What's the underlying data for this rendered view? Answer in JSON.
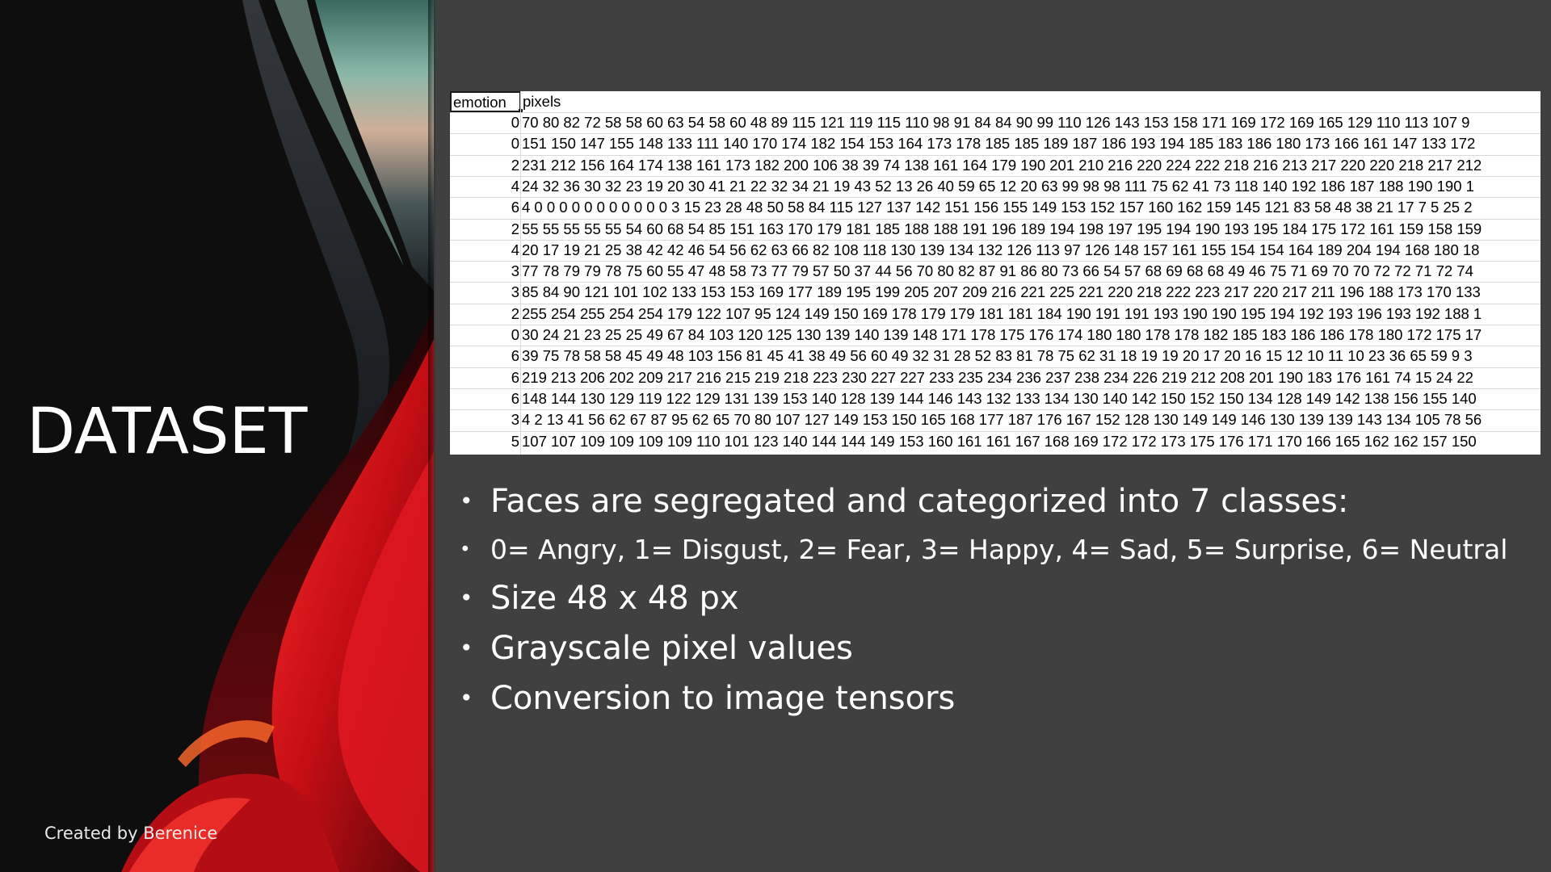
{
  "slide": {
    "title": "DATASET",
    "credit": "Created by Berenice"
  },
  "spreadsheet": {
    "columns": [
      "emotion",
      "pixels"
    ],
    "rows": [
      {
        "emotion": "0",
        "pixels": "70 80 82 72 58 58 60 63 54 58 60 48 89 115 121 119 115 110 98 91 84 84 90 99 110 126 143 153 158 171 169 172 169 165 129 110 113 107 9"
      },
      {
        "emotion": "0",
        "pixels": "151 150 147 155 148 133 111 140 170 174 182 154 153 164 173 178 185 185 189 187 186 193 194 185 183 186 180 173 166 161 147 133 172"
      },
      {
        "emotion": "2",
        "pixels": "231 212 156 164 174 138 161 173 182 200 106 38 39 74 138 161 164 179 190 201 210 216 220 224 222 218 216 213 217 220 220 218 217 212"
      },
      {
        "emotion": "4",
        "pixels": "24 32 36 30 32 23 19 20 30 41 21 22 32 34 21 19 43 52 13 26 40 59 65 12 20 63 99 98 98 111 75 62 41 73 118 140 192 186 187 188 190 190 1"
      },
      {
        "emotion": "6",
        "pixels": "4 0 0 0 0 0 0 0 0 0 0 0 3 15 23 28 48 50 58 84 115 127 137 142 151 156 155 149 153 152 157 160 162 159 145 121 83 58 48 38 21 17 7 5 25 2"
      },
      {
        "emotion": "2",
        "pixels": "55 55 55 55 55 54 60 68 54 85 151 163 170 179 181 185 188 188 191 196 189 194 198 197 195 194 190 193 195 184 175 172 161 159 158 159"
      },
      {
        "emotion": "4",
        "pixels": "20 17 19 21 25 38 42 42 46 54 56 62 63 66 82 108 118 130 139 134 132 126 113 97 126 148 157 161 155 154 154 164 189 204 194 168 180 18"
      },
      {
        "emotion": "3",
        "pixels": "77 78 79 79 78 75 60 55 47 48 58 73 77 79 57 50 37 44 56 70 80 82 87 91 86 80 73 66 54 57 68 69 68 68 49 46 75 71 69 70 70 72 72 71 72 74"
      },
      {
        "emotion": "3",
        "pixels": "85 84 90 121 101 102 133 153 153 169 177 189 195 199 205 207 209 216 221 225 221 220 218 222 223 217 220 217 211 196 188 173 170 133"
      },
      {
        "emotion": "2",
        "pixels": "255 254 255 254 254 179 122 107 95 124 149 150 169 178 179 179 181 181 184 190 191 191 193 190 190 195 194 192 193 196 193 192 188 1"
      },
      {
        "emotion": "0",
        "pixels": "30 24 21 23 25 25 49 67 84 103 120 125 130 139 140 139 148 171 178 175 176 174 180 180 178 178 182 185 183 186 186 178 180 172 175 17"
      },
      {
        "emotion": "6",
        "pixels": "39 75 78 58 58 45 49 48 103 156 81 45 41 38 49 56 60 49 32 31 28 52 83 81 78 75 62 31 18 19 19 20 17 20 16 15 12 10 11 10 23 36 65 59 9 3"
      },
      {
        "emotion": "6",
        "pixels": "219 213 206 202 209 217 216 215 219 218 223 230 227 227 233 235 234 236 237 238 234 226 219 212 208 201 190 183 176 161 74 15 24 22"
      },
      {
        "emotion": "6",
        "pixels": "148 144 130 129 119 122 129 131 139 153 140 128 139 144 146 143 132 133 134 130 140 142 150 152 150 134 128 149 142 138 156 155 140"
      },
      {
        "emotion": "3",
        "pixels": "4 2 13 41 56 62 67 87 95 62 65 70 80 107 127 149 153 150 165 168 177 187 176 167 152 128 130 149 149 146 130 139 139 143 134 105 78 56"
      },
      {
        "emotion": "5",
        "pixels": "107 107 109 109 109 109 110 101 123 140 144 144 149 153 160 161 161 167 168 169 172 172 173 175 176 171 170 166 165 162 162 157 150"
      }
    ]
  },
  "bullets": [
    {
      "text": "Faces are segregated and categorized into 7 classes:",
      "size": "large"
    },
    {
      "text": "0= Angry, 1= Disgust, 2= Fear, 3= Happy, 4= Sad, 5= Surprise, 6= Neutral",
      "size": "small"
    },
    {
      "text": "Size 48 x 48 px",
      "size": "large"
    },
    {
      "text": "Grayscale pixel values",
      "size": "large"
    },
    {
      "text": "Conversion to image tensors",
      "size": "large"
    }
  ],
  "theme": {
    "background": "#404040",
    "left_panel": "#0e0e0f",
    "accent_red": "#d0121a",
    "accent_teal": "#5f9a8c",
    "text": "#ffffff"
  }
}
